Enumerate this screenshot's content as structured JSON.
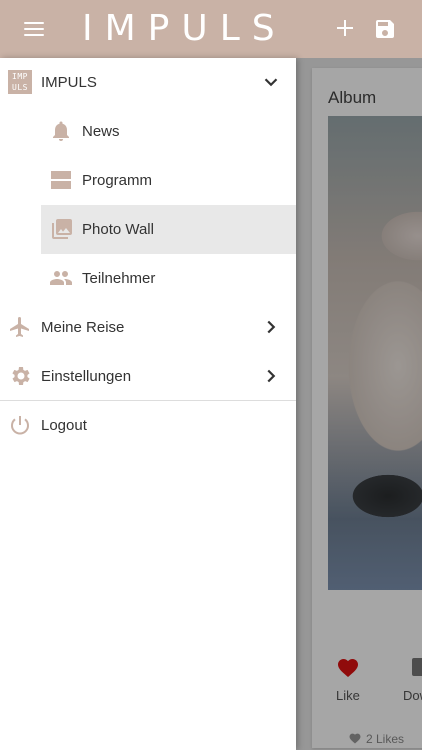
{
  "app": {
    "logo": "IMPULS"
  },
  "colors": {
    "brand": "#c9b2a6",
    "icon": "#c9b2a6",
    "active_bg": "#e8e8e8"
  },
  "drawer": {
    "group": {
      "label": "IMPULS",
      "brand_icon_text": "IMPULS",
      "expanded": true
    },
    "sub_items": [
      {
        "label": "News",
        "icon": "bell-icon"
      },
      {
        "label": "Programm",
        "icon": "agenda-icon"
      },
      {
        "label": "Photo Wall",
        "icon": "photo-library-icon",
        "active": true
      },
      {
        "label": "Teilnehmer",
        "icon": "people-icon"
      }
    ],
    "items": [
      {
        "label": "Meine Reise",
        "icon": "airplane-icon"
      },
      {
        "label": "Einstellungen",
        "icon": "gear-icon"
      }
    ],
    "logout": {
      "label": "Logout",
      "icon": "power-icon"
    }
  },
  "background": {
    "album_title": "Album",
    "like_label": "Like",
    "download_label": "Down",
    "likes_count": "2 Likes"
  }
}
